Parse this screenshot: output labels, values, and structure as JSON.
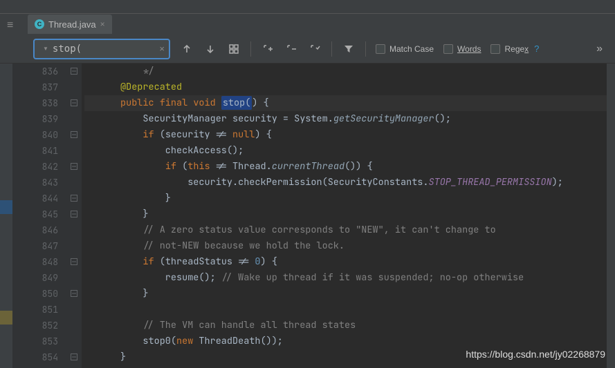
{
  "tab": {
    "title": "Thread.java",
    "icon_letter": "C"
  },
  "search": {
    "value": "stop("
  },
  "options": {
    "matchcase": "Match Case",
    "words": "Words",
    "regex": "Regex",
    "help": "?"
  },
  "gutter_start": 836,
  "code": [
    {
      "n": 836,
      "indent": 1,
      "tokens": [
        {
          "t": "*/",
          "c": "c-comment"
        }
      ]
    },
    {
      "n": 837,
      "indent": 0,
      "tokens": [
        {
          "t": "@Deprecated",
          "c": "c-annotation"
        }
      ]
    },
    {
      "n": 838,
      "indent": 0,
      "hl": true,
      "tokens": [
        {
          "t": "public ",
          "c": "c-kw"
        },
        {
          "t": "final ",
          "c": "c-kw"
        },
        {
          "t": "void ",
          "c": "c-kw"
        },
        {
          "t": "stop(",
          "sel": true
        },
        {
          "t": ") {"
        }
      ]
    },
    {
      "n": 839,
      "indent": 1,
      "tokens": [
        {
          "t": "SecurityManager security = System."
        },
        {
          "t": "getSecurityManager",
          "c": "c-it"
        },
        {
          "t": "();"
        }
      ]
    },
    {
      "n": 840,
      "indent": 1,
      "tokens": [
        {
          "t": "if ",
          "c": "c-kw"
        },
        {
          "t": "(security != "
        },
        {
          "t": "null",
          "c": "c-kw"
        },
        {
          "t": ") {"
        }
      ]
    },
    {
      "n": 841,
      "indent": 2,
      "tokens": [
        {
          "t": "checkAccess();"
        }
      ]
    },
    {
      "n": 842,
      "indent": 2,
      "tokens": [
        {
          "t": "if ",
          "c": "c-kw"
        },
        {
          "t": "("
        },
        {
          "t": "this",
          "c": "c-kw"
        },
        {
          "t": " != Thread."
        },
        {
          "t": "currentThread",
          "c": "c-it"
        },
        {
          "t": "()) {"
        }
      ]
    },
    {
      "n": 843,
      "indent": 3,
      "tokens": [
        {
          "t": "security.checkPermission(SecurityConstants."
        },
        {
          "t": "STOP_THREAD_PERMISSION",
          "c": "c-static"
        },
        {
          "t": ");"
        }
      ]
    },
    {
      "n": 844,
      "indent": 2,
      "tokens": [
        {
          "t": "}"
        }
      ]
    },
    {
      "n": 845,
      "indent": 1,
      "tokens": [
        {
          "t": "}"
        }
      ]
    },
    {
      "n": 846,
      "indent": 1,
      "tokens": [
        {
          "t": "// A zero status value corresponds to \"NEW\", it can't change to",
          "c": "c-comment"
        }
      ]
    },
    {
      "n": 847,
      "indent": 1,
      "tokens": [
        {
          "t": "// not-NEW because we hold the lock.",
          "c": "c-comment"
        }
      ]
    },
    {
      "n": 848,
      "indent": 1,
      "tokens": [
        {
          "t": "if ",
          "c": "c-kw"
        },
        {
          "t": "(threadStatus != "
        },
        {
          "t": "0",
          "c": "c-num"
        },
        {
          "t": ") {"
        }
      ]
    },
    {
      "n": 849,
      "indent": 2,
      "tokens": [
        {
          "t": "resume(); "
        },
        {
          "t": "// Wake up thread if it was suspended; no-op otherwise",
          "c": "c-comment"
        }
      ]
    },
    {
      "n": 850,
      "indent": 1,
      "tokens": [
        {
          "t": "}"
        }
      ]
    },
    {
      "n": 851,
      "indent": 1,
      "tokens": []
    },
    {
      "n": 852,
      "indent": 1,
      "tokens": [
        {
          "t": "// The VM can handle all thread states",
          "c": "c-comment"
        }
      ]
    },
    {
      "n": 853,
      "indent": 1,
      "tokens": [
        {
          "t": "stop0("
        },
        {
          "t": "new ",
          "c": "c-kw"
        },
        {
          "t": "ThreadDeath());"
        }
      ]
    },
    {
      "n": 854,
      "indent": 0,
      "tokens": [
        {
          "t": "}"
        }
      ]
    }
  ],
  "folds": [
    0,
    2,
    4,
    6,
    8,
    9,
    12,
    14,
    18
  ],
  "watermark": "https://blog.csdn.net/jy02268879"
}
